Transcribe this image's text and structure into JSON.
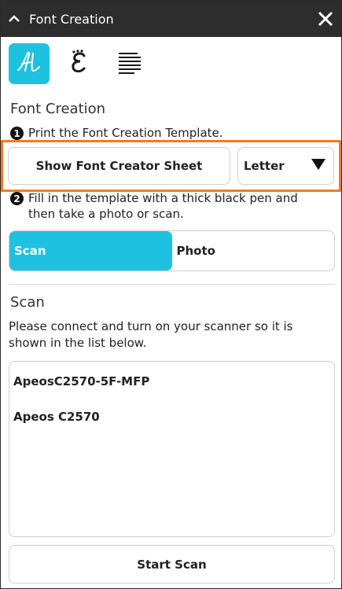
{
  "titlebar": {
    "title": "Font Creation",
    "collapse_icon": "chevron-up-icon",
    "close_icon": "close-icon"
  },
  "toolbar": {
    "tools": [
      {
        "name": "font-creation-tool",
        "active": true
      },
      {
        "name": "font-style-tool",
        "active": false
      },
      {
        "name": "text-align-tool",
        "active": false
      }
    ]
  },
  "main": {
    "section_title": "Font Creation",
    "step1": {
      "num": "1",
      "text": "Print the Font Creation Template."
    },
    "show_sheet_label": "Show Font Creator Sheet",
    "paper_size": "Letter",
    "step2": {
      "num": "2",
      "text": "Fill in the template with a thick black pen and then take a photo or scan."
    },
    "segments": [
      {
        "label": "Scan",
        "active": true
      },
      {
        "label": "Photo",
        "active": false
      }
    ],
    "scan_title": "Scan",
    "scan_description": "Please connect and turn on your scanner so it is shown in the list below.",
    "scanners": [
      "ApeosC2570-5F-MFP",
      "Apeos C2570"
    ],
    "start_scan_label": "Start Scan"
  },
  "colors": {
    "accent": "#1fc1e0",
    "highlight": "#f47b20",
    "titlebar": "#2d2d2d"
  }
}
